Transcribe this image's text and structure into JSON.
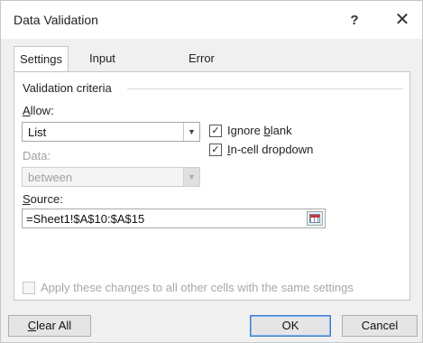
{
  "window": {
    "title": "Data Validation",
    "help_label": "?",
    "close_label": "✕"
  },
  "tabs": [
    {
      "label": "Settings",
      "active": true
    },
    {
      "label": "Input Message",
      "active": false
    },
    {
      "label": "Error Alert",
      "active": false
    }
  ],
  "validation": {
    "section_label": "Validation criteria",
    "allow": {
      "label_pre": "",
      "label_ul": "A",
      "label_post": "llow:",
      "value": "List"
    },
    "data": {
      "label": "Data:",
      "value": "between"
    },
    "source": {
      "label_pre": "",
      "label_ul": "S",
      "label_post": "ource:",
      "value": "=Sheet1!$A$10:$A$15"
    },
    "ignore_blank": {
      "label_pre": "Ignore ",
      "label_ul": "b",
      "label_post": "lank",
      "checked": true
    },
    "in_cell_dropdown": {
      "label_pre": "",
      "label_ul": "I",
      "label_post": "n-cell dropdown",
      "checked": true
    }
  },
  "apply_all": {
    "label": "Apply these changes to all other cells with the same settings",
    "checked": false
  },
  "footer": {
    "clear_all": {
      "label_ul": "C",
      "label_post": "lear All"
    },
    "ok": "OK",
    "cancel": "Cancel"
  },
  "icons": {
    "dropdown": "chevron-down-icon",
    "range_picker": "range-select-icon",
    "checkmark": "✓"
  },
  "colors": {
    "dialog_bg": "#f0f0f0",
    "panel_bg": "#ffffff",
    "primary_border": "#3c7fd1"
  }
}
